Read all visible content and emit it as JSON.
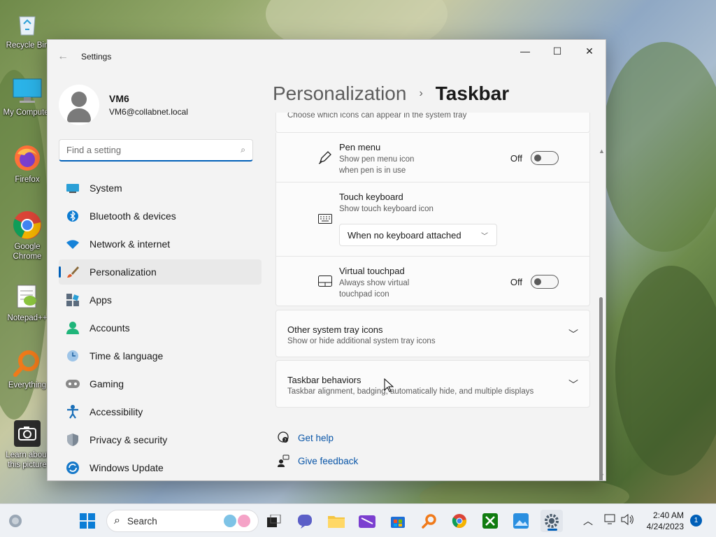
{
  "desktop": {
    "icons": [
      {
        "label": "Recycle Bin",
        "icon": "recycle-bin-icon"
      },
      {
        "label": "My Computer",
        "icon": "computer-icon"
      },
      {
        "label": "Firefox",
        "icon": "firefox-icon"
      },
      {
        "label": "Google Chrome",
        "icon": "chrome-icon"
      },
      {
        "label": "Notepad++",
        "icon": "notepad-plus-plus-icon"
      },
      {
        "label": "Everything",
        "icon": "everything-search-icon"
      },
      {
        "label": "Learn about this picture",
        "icon": "camera-icon"
      }
    ]
  },
  "window": {
    "title": "Settings",
    "controls": {
      "minimize": "—",
      "maximize": "☐",
      "close": "✕"
    }
  },
  "profile": {
    "name": "VM6",
    "email": "VM6@collabnet.local"
  },
  "search": {
    "placeholder": "Find a setting"
  },
  "nav": {
    "items": [
      {
        "label": "System",
        "icon": "system-display-icon"
      },
      {
        "label": "Bluetooth & devices",
        "icon": "bluetooth-icon"
      },
      {
        "label": "Network & internet",
        "icon": "wifi-icon"
      },
      {
        "label": "Personalization",
        "icon": "paintbrush-icon",
        "active": true
      },
      {
        "label": "Apps",
        "icon": "apps-icon"
      },
      {
        "label": "Accounts",
        "icon": "accounts-icon"
      },
      {
        "label": "Time & language",
        "icon": "clock-globe-icon"
      },
      {
        "label": "Gaming",
        "icon": "gamepad-icon"
      },
      {
        "label": "Accessibility",
        "icon": "accessibility-icon"
      },
      {
        "label": "Privacy & security",
        "icon": "shield-icon"
      },
      {
        "label": "Windows Update",
        "icon": "update-icon"
      }
    ]
  },
  "breadcrumb": {
    "parent": "Personalization",
    "separator": "›",
    "current": "Taskbar"
  },
  "system_tray_section": {
    "description": "Choose which icons can appear in the system tray",
    "pen_menu": {
      "title": "Pen menu",
      "description_line1": "Show pen menu icon",
      "description_line2": "when pen is in use",
      "state": "Off"
    },
    "touch_keyboard": {
      "title": "Touch keyboard",
      "description": "Show touch keyboard icon",
      "selected": "When no keyboard attached"
    },
    "virtual_touchpad": {
      "title": "Virtual touchpad",
      "description_line1": "Always show virtual",
      "description_line2": "touchpad icon",
      "state": "Off"
    }
  },
  "other_tray": {
    "title": "Other system tray icons",
    "description": "Show or hide additional system tray icons"
  },
  "behaviors": {
    "title": "Taskbar behaviors",
    "description": "Taskbar alignment, badging, automatically hide, and multiple displays"
  },
  "help": {
    "get_help": "Get help",
    "give_feedback": "Give feedback"
  },
  "taskbar": {
    "search_label": "Search",
    "time": "2:40 AM",
    "date": "4/24/2023",
    "notification_count": "1"
  },
  "colors": {
    "accent": "#005fb8",
    "link": "#0a56a8"
  }
}
